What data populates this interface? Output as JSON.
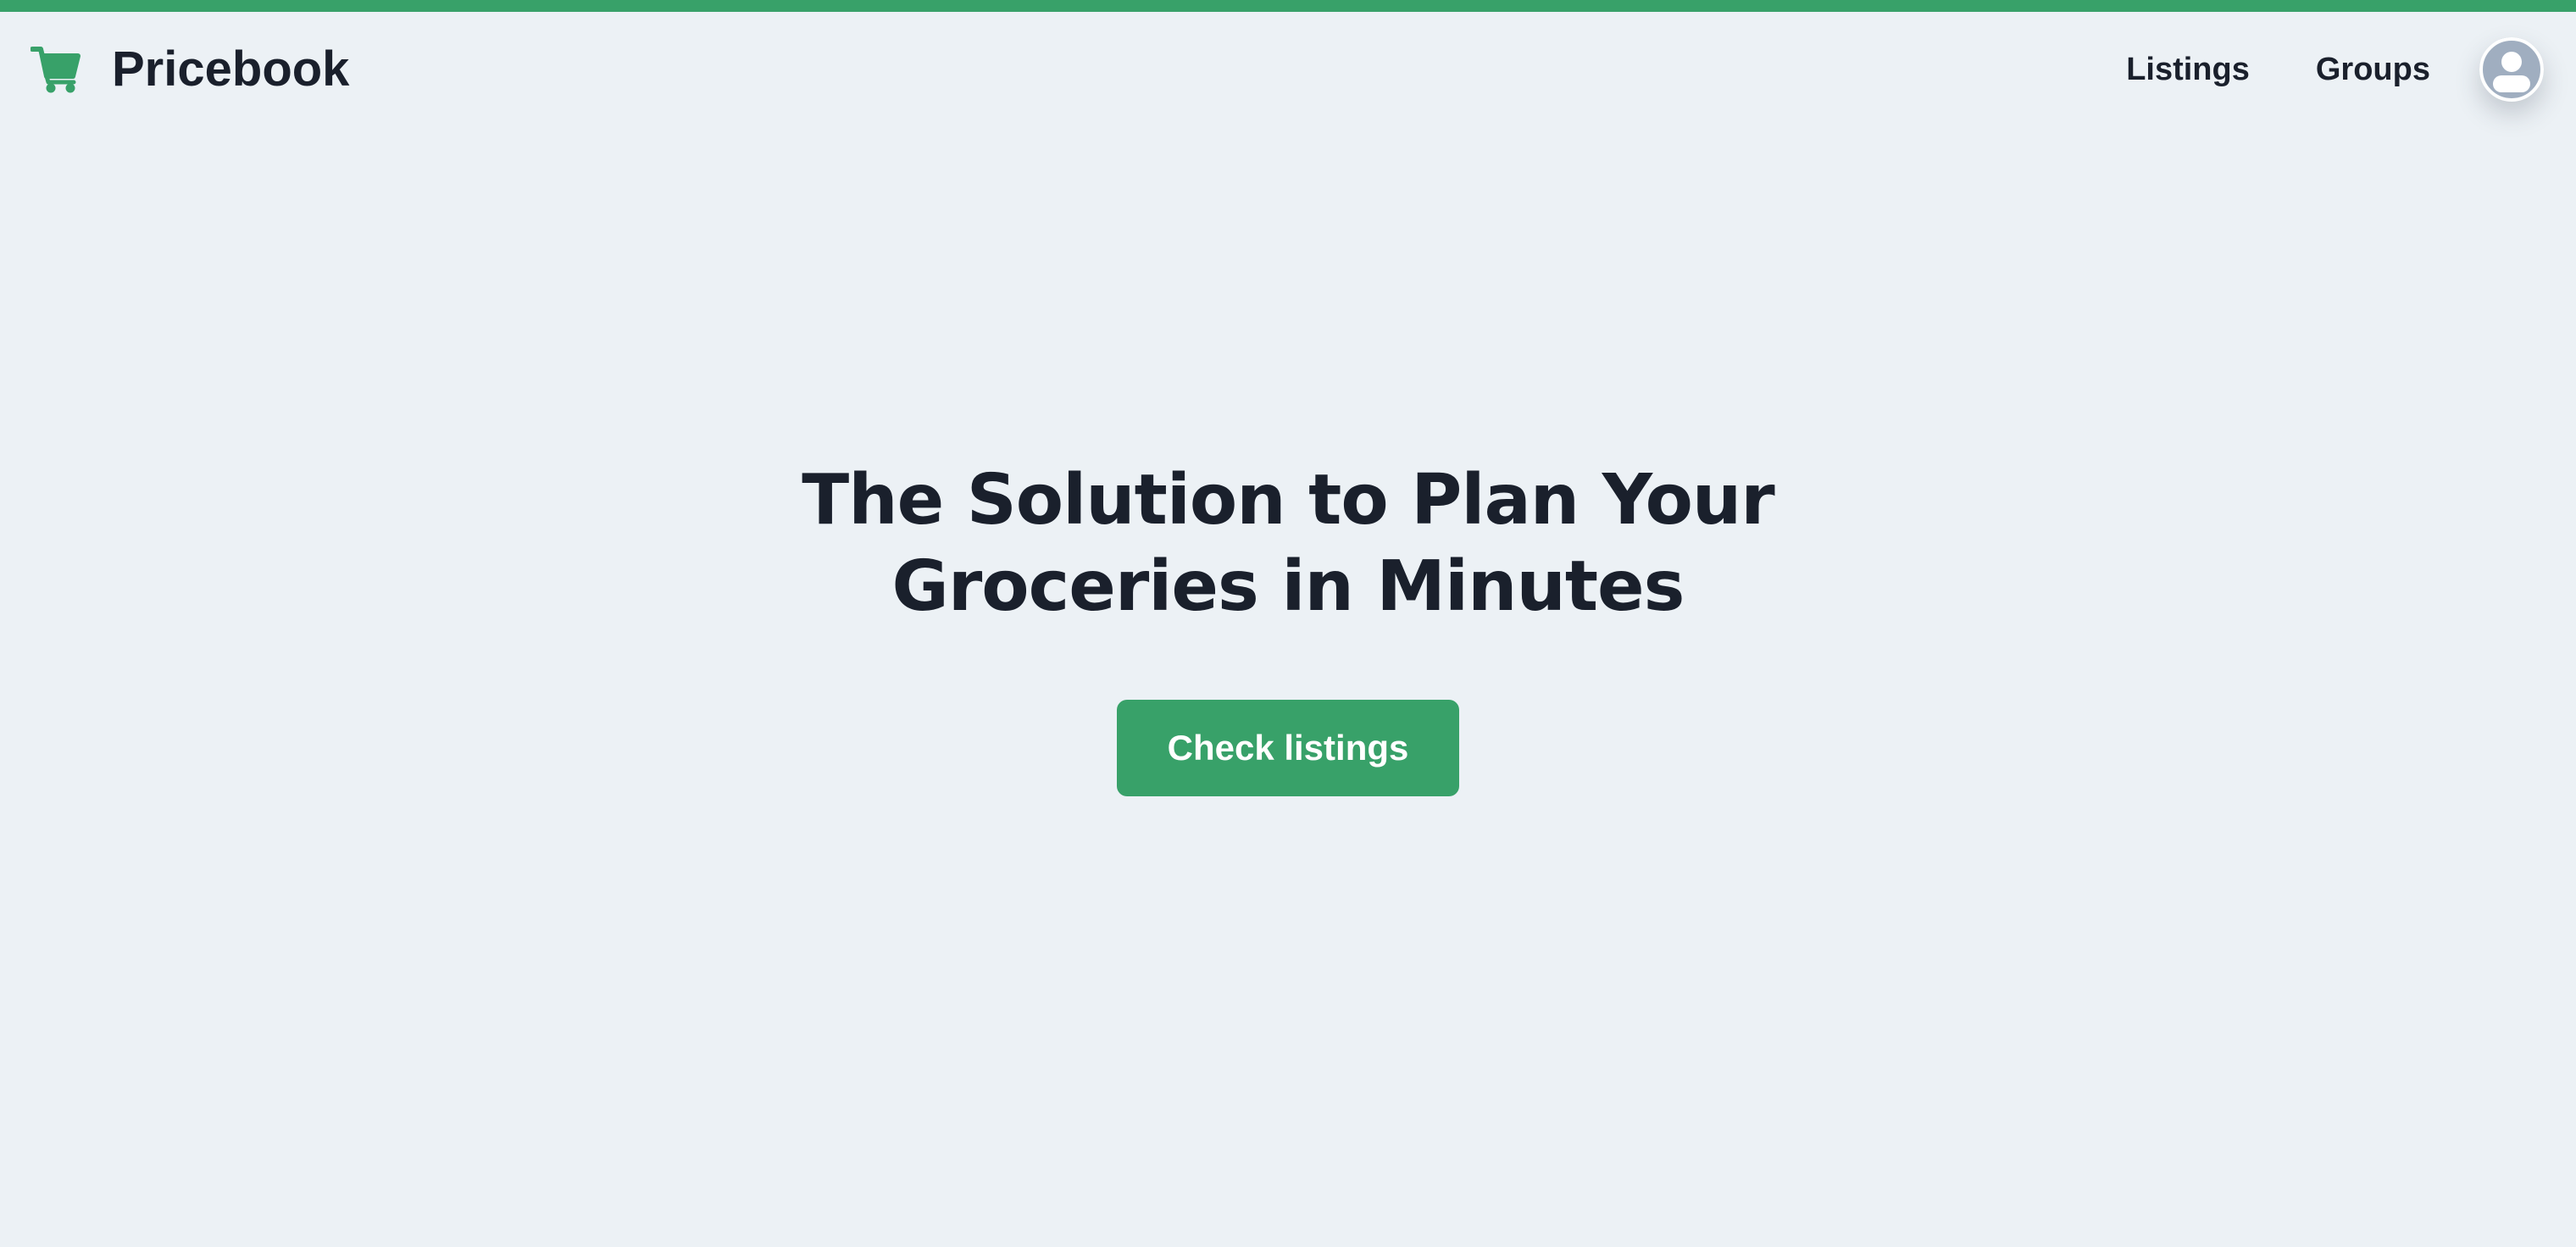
{
  "colors": {
    "accent": "#38a169",
    "background": "#ecf1f5",
    "text": "#1a202c",
    "avatar": "#a0aec0"
  },
  "brand": {
    "icon": "shopping-cart-icon",
    "name": "Pricebook"
  },
  "nav": {
    "links": [
      {
        "label": "Listings"
      },
      {
        "label": "Groups"
      }
    ],
    "avatar_icon": "user-avatar-icon"
  },
  "hero": {
    "title_line1": "The Solution to Plan Your",
    "title_line2": "Groceries in Minutes",
    "cta_label": "Check listings"
  }
}
